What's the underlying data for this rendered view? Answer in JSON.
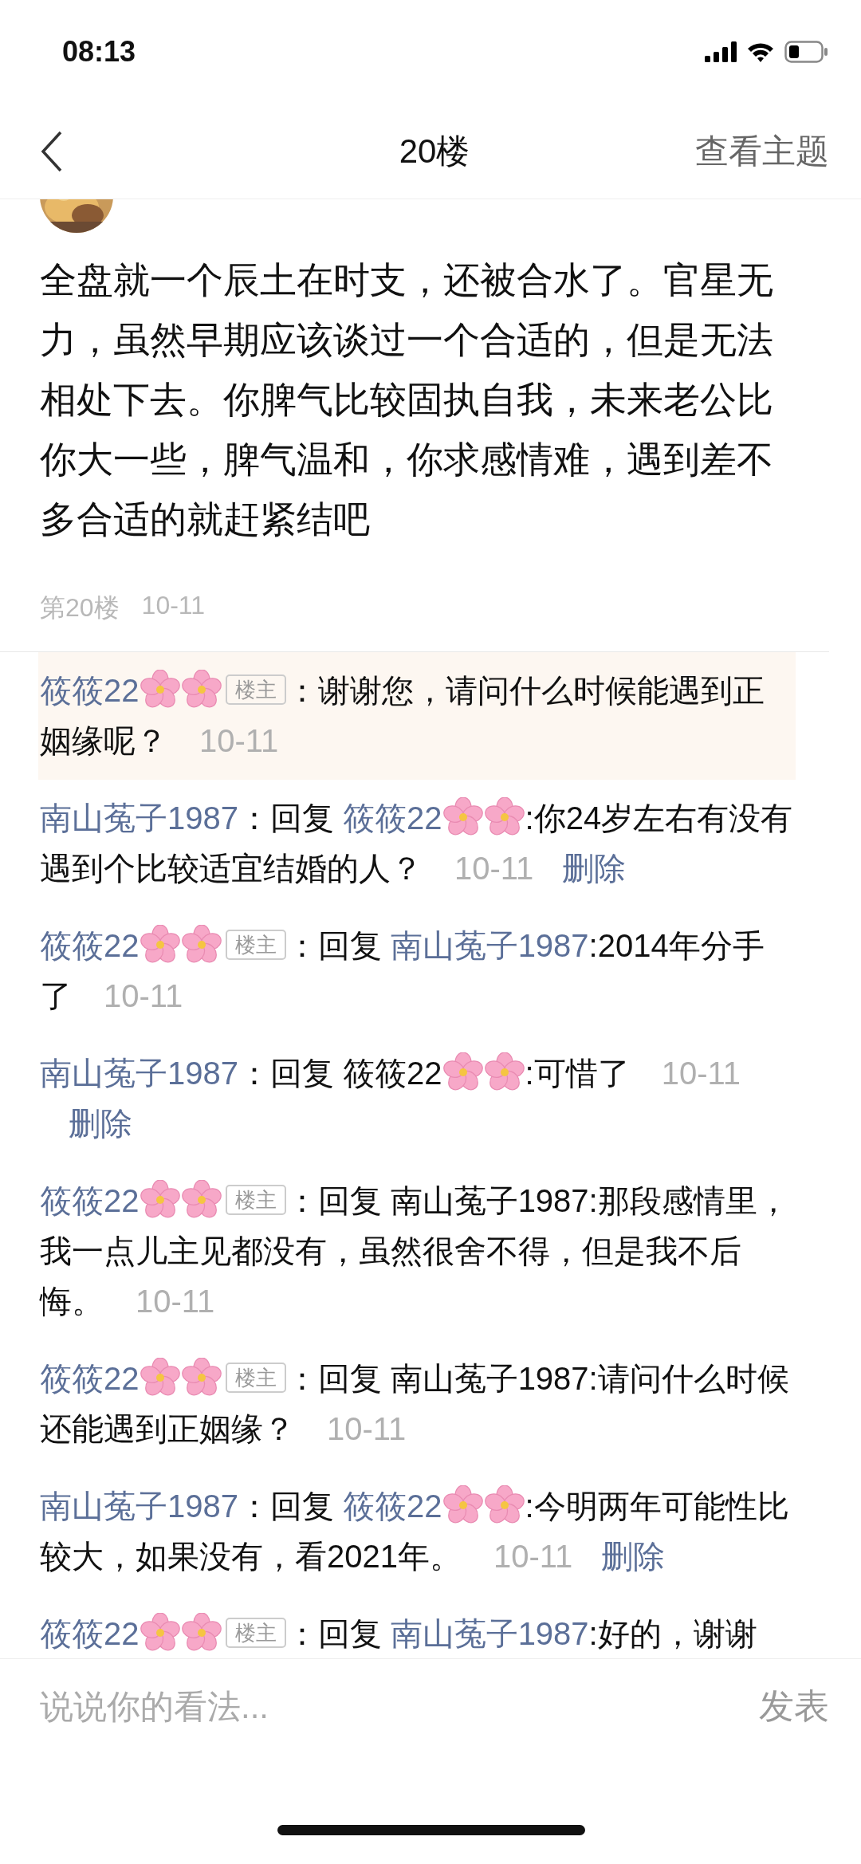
{
  "status_bar": {
    "time": "08:13"
  },
  "nav": {
    "title": "20楼",
    "action": "查看主题"
  },
  "post": {
    "text": "全盘就一个辰土在时支，还被合水了。官星无力，虽然早期应该谈过一个合适的，但是无法相处下去。你脾气比较固执自我，未来老公比你大一些，脾气温和，你求感情难，遇到差不多合适的就赶紧结吧",
    "floor": "第20楼",
    "time": "10-11"
  },
  "replies": [
    {
      "author": "筱筱22",
      "author_decorated": true,
      "badge": "楼主",
      "text": "：谢谢您，请问什么时候能遇到正姻缘呢？",
      "time": "10-11",
      "highlighted": true
    },
    {
      "author": "南山菟子1987",
      "author_decorated": false,
      "prefix": "：回复",
      "reply_to": {
        "name": "筱筱22",
        "decorated": true,
        "linked": true
      },
      "text": ":你24岁左右有没有遇到个比较适宜结婚的人？",
      "time": "10-11",
      "delete": "删除",
      "highlighted": false
    },
    {
      "author": "筱筱22",
      "author_decorated": true,
      "badge": "楼主",
      "prefix": "：回复",
      "reply_to": {
        "name": "南山菟子1987",
        "decorated": false,
        "linked": true
      },
      "text": ":2014年分手了",
      "time": "10-11",
      "highlighted": false
    },
    {
      "author": "南山菟子1987",
      "author_decorated": false,
      "prefix": "：回复",
      "reply_to": {
        "name": "筱筱22",
        "decorated": true,
        "linked": false
      },
      "text": ":可惜了",
      "time": "10-11",
      "delete": "删除",
      "highlighted": false
    },
    {
      "author": "筱筱22",
      "author_decorated": true,
      "badge": "楼主",
      "prefix": "：回复",
      "reply_to": {
        "name": "南山菟子1987",
        "decorated": false,
        "linked": false
      },
      "text": ":那段感情里，我一点儿主见都没有，虽然很舍不得，但是我不后悔。",
      "time": "10-11",
      "highlighted": false
    },
    {
      "author": "筱筱22",
      "author_decorated": true,
      "badge": "楼主",
      "prefix": "：回复",
      "reply_to": {
        "name": "南山菟子1987",
        "decorated": false,
        "linked": false
      },
      "text": ":请问什么时候还能遇到正姻缘？",
      "time": "10-11",
      "highlighted": false
    },
    {
      "author": "南山菟子1987",
      "author_decorated": false,
      "prefix": "：回复",
      "reply_to": {
        "name": "筱筱22",
        "decorated": true,
        "linked": true
      },
      "text": ":今明两年可能性比较大，如果没有，看2021年。",
      "time": "10-11",
      "delete": "删除",
      "highlighted": false
    },
    {
      "author": "筱筱22",
      "author_decorated": true,
      "badge": "楼主",
      "prefix": "：回复",
      "reply_to": {
        "name": "南山菟子1987",
        "decorated": false,
        "linked": true
      },
      "text": ":好的，谢谢",
      "highlighted": false
    }
  ],
  "comment_bar": {
    "placeholder": "说说你的看法...",
    "submit": "发表"
  }
}
